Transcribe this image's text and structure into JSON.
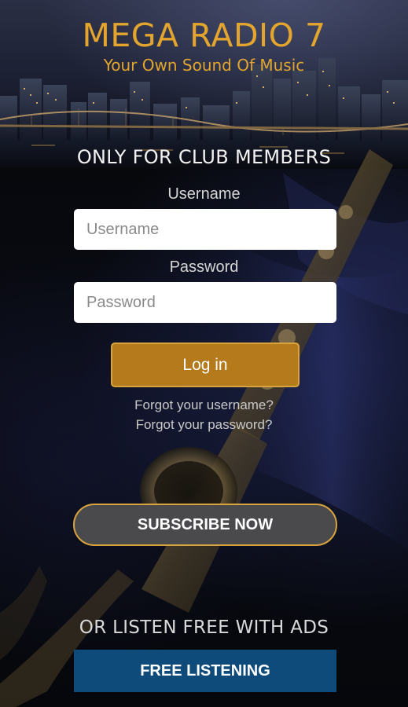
{
  "header": {
    "title": "MEGA RADIO 7",
    "tagline": "Your Own Sound Of Music"
  },
  "login": {
    "heading": "ONLY FOR CLUB MEMBERS",
    "username_label": "Username",
    "username_placeholder": "Username",
    "username_value": "",
    "password_label": "Password",
    "password_placeholder": "Password",
    "password_value": "",
    "login_label": "Log in",
    "forgot_username": "Forgot your username?",
    "forgot_password": "Forgot your password?"
  },
  "subscribe": {
    "label": "SUBSCRIBE NOW"
  },
  "free": {
    "heading": "OR LISTEN FREE WITH ADS",
    "button_label": "FREE LISTENING"
  },
  "colors": {
    "accent_gold": "#e3a52d",
    "login_button": "#b57a1c",
    "subscribe_button": "#4a4a4c",
    "free_button": "#0e4a7a",
    "background": "#07080c"
  }
}
